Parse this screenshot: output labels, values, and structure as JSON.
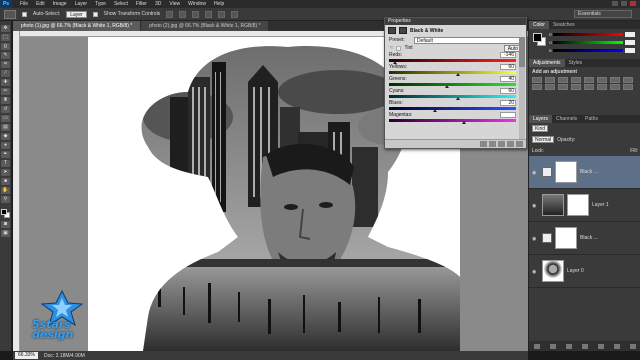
{
  "app": {
    "logo": "Ps",
    "menu": [
      "File",
      "Edit",
      "Image",
      "Layer",
      "Type",
      "Select",
      "Filter",
      "3D",
      "View",
      "Window",
      "Help"
    ]
  },
  "options": {
    "auto_select_label": "Auto-Select:",
    "auto_select_value": "Layer",
    "transform_label": "Show Transform Controls",
    "workspace": "Essentials"
  },
  "document": {
    "tabs": [
      "photo (1).jpg @ 66.7% (Black & White 1, RGB/8) *",
      "photo (2).jpg @ 66.7% (Black & White 1, RGB/8) *"
    ],
    "zoom": "66.33%",
    "doc_size": "Doc: 2.18M/4.90M"
  },
  "properties": {
    "title": "Properties",
    "adjustment": "Black & White",
    "preset_label": "Preset:",
    "preset_value": "Default",
    "tint_label": "Tint",
    "auto_label": "Auto",
    "sliders": [
      {
        "label": "Reds:",
        "value": "-146",
        "pos": 0.05,
        "grad": "linear-gradient(to right,#2a0000,#ff2020)"
      },
      {
        "label": "Yellows:",
        "value": "60",
        "pos": 0.55,
        "grad": "linear-gradient(to right,#2a2a00,#ffff30)"
      },
      {
        "label": "Greens:",
        "value": "40",
        "pos": 0.46,
        "grad": "linear-gradient(to right,#002a00,#30e030)"
      },
      {
        "label": "Cyans:",
        "value": "60",
        "pos": 0.55,
        "grad": "linear-gradient(to right,#002a2a,#30f0f0)"
      },
      {
        "label": "Blues:",
        "value": "20",
        "pos": 0.37,
        "grad": "linear-gradient(to right,#00002a,#3050ff)"
      },
      {
        "label": "Magentas:",
        "value": "",
        "pos": 0.6,
        "grad": "linear-gradient(to right,#2a002a,#f030f0)"
      }
    ]
  },
  "color_panel": {
    "tabs": [
      "Color",
      "Swatches"
    ],
    "rows": [
      {
        "label": "R",
        "grad": "linear-gradient(to right,#000,#f00)"
      },
      {
        "label": "G",
        "grad": "linear-gradient(to right,#000,#0f0)"
      },
      {
        "label": "B",
        "grad": "linear-gradient(to right,#000,#00f)"
      }
    ]
  },
  "adjustments_panel": {
    "tabs": [
      "Adjustments",
      "Styles"
    ],
    "title": "Add an adjustment"
  },
  "layers_panel": {
    "tabs": [
      "Layers",
      "Channels",
      "Paths"
    ],
    "kind": "Kind",
    "blend_mode": "Normal",
    "opacity_label": "Opacity:",
    "fill_label": "Fill:",
    "lock_label": "Lock:",
    "layers": [
      {
        "name": "Black ...",
        "type": "adjustment",
        "selected": true
      },
      {
        "name": "Layer 1",
        "type": "image-city",
        "selected": false
      },
      {
        "name": "Black ...",
        "type": "adjustment",
        "selected": false
      },
      {
        "name": "Layer 0",
        "type": "image-man",
        "selected": false
      }
    ]
  },
  "watermark": {
    "line1": "5stars",
    "line2": "design"
  }
}
